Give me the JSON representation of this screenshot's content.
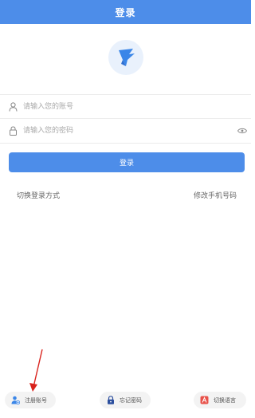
{
  "header": {
    "title": "登录"
  },
  "form": {
    "account_placeholder": "请输入您的账号",
    "password_placeholder": "请输入您的密码",
    "login_label": "登录"
  },
  "links": {
    "switch_login": "切换登录方式",
    "change_phone": "修改手机号码"
  },
  "bottom": {
    "register": "注册账号",
    "forgot": "忘记密码",
    "language": "切换语言"
  },
  "icons": {
    "logo": "bird-logo-icon",
    "user": "user-icon",
    "lock": "lock-icon",
    "eye": "eye-icon",
    "register": "add-user-icon",
    "forgot": "padlock-icon",
    "language": "language-icon",
    "arrow": "red-arrow-icon"
  },
  "colors": {
    "primary": "#4d8de9",
    "arrow": "#d9231d"
  }
}
